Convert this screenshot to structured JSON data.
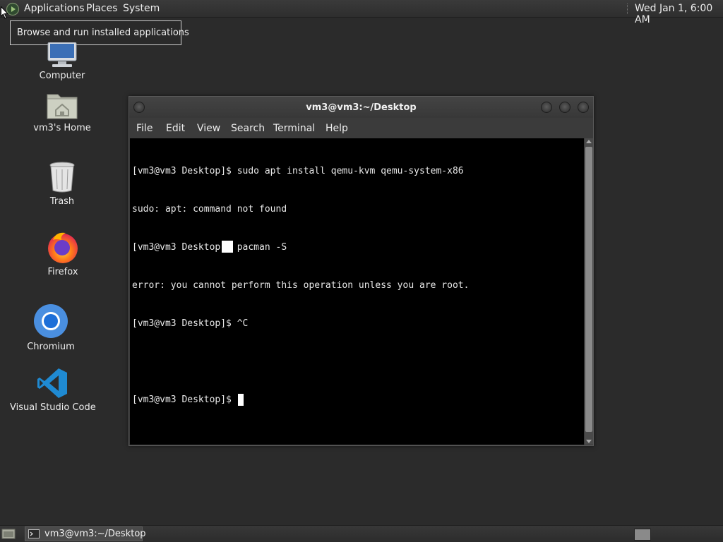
{
  "top_panel": {
    "applications": "Applications",
    "places": "Places",
    "system": "System",
    "clock": "Wed Jan 1, 6:00 AM"
  },
  "tooltip": "Browse and run installed applications",
  "desktop_icons": {
    "computer": "Computer",
    "home": "vm3's Home",
    "trash": "Trash",
    "firefox": "Firefox",
    "chromium": "Chromium",
    "vscode": "Visual Studio Code"
  },
  "terminal": {
    "title": "vm3@vm3:~/Desktop",
    "menu": {
      "file": "File",
      "edit": "Edit",
      "view": "View",
      "search": "Search",
      "terminal": "Terminal",
      "help": "Help"
    },
    "lines": [
      "[vm3@vm3 Desktop]$ sudo apt install qemu-kvm qemu-system-x86",
      "sudo: apt: command not found",
      "[vm3@vm3 Desktop]$ pacman -S",
      "error: you cannot perform this operation unless you are root.",
      "[vm3@vm3 Desktop]$ ^C",
      "",
      "[vm3@vm3 Desktop]$ "
    ]
  },
  "taskbar": {
    "task_label": "vm3@vm3:~/Desktop"
  },
  "colors": {
    "desktop_bg": "#2b2b2b",
    "terminal_bg": "#000000",
    "terminal_fg": "#e8e8e8",
    "vscode_blue": "#1f8ad2",
    "chromium_blue": "#4a8fe0"
  },
  "icons": {
    "applications": "applications-menu-icon",
    "computer": "computer-monitor-icon",
    "home": "home-folder-icon",
    "trash": "trash-can-icon",
    "firefox": "firefox-icon",
    "chromium": "chromium-icon",
    "vscode": "vscode-icon"
  }
}
